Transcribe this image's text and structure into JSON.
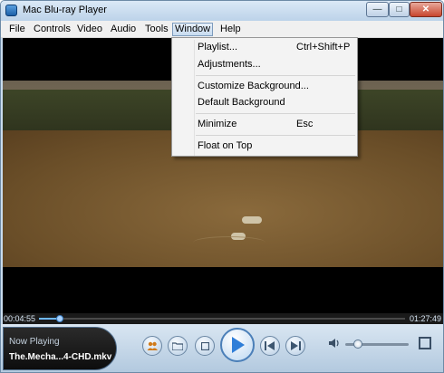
{
  "window": {
    "title": "Mac Blu-ray Player",
    "min_glyph": "—",
    "max_glyph": "□",
    "close_glyph": "✕"
  },
  "menubar": {
    "items": [
      "File",
      "Controls",
      "Video",
      "Audio",
      "Tools",
      "Window",
      "Help"
    ],
    "active": "Window"
  },
  "window_menu": {
    "items": [
      {
        "label": "Playlist...",
        "shortcut": "Ctrl+Shift+P"
      },
      {
        "label": "Adjustments...",
        "shortcut": ""
      },
      {
        "label": "Customize Background...",
        "shortcut": ""
      },
      {
        "label": "Default Background",
        "shortcut": ""
      },
      {
        "label": "Minimize",
        "shortcut": "Esc"
      },
      {
        "label": "Float on Top",
        "shortcut": ""
      }
    ]
  },
  "playback": {
    "current_time": "00:04:55",
    "duration": "01:27:49",
    "progress": 0.056
  },
  "now_playing": {
    "label": "Now Playing",
    "file": "The.Mecha...4-CHD.mkv"
  },
  "volume": {
    "level": 0.2
  },
  "icons": {
    "app": "app-icon",
    "users": "users-icon",
    "folder": "folder-icon",
    "stop": "stop-icon",
    "play": "play-icon",
    "previous": "previous-icon",
    "next": "next-icon",
    "volume": "volume-icon",
    "fullscreen": "fullscreen-icon"
  },
  "colors": {
    "accent": "#1b5fa8",
    "seek_fill": "#6fb8ff",
    "video_bg": "#000000"
  }
}
